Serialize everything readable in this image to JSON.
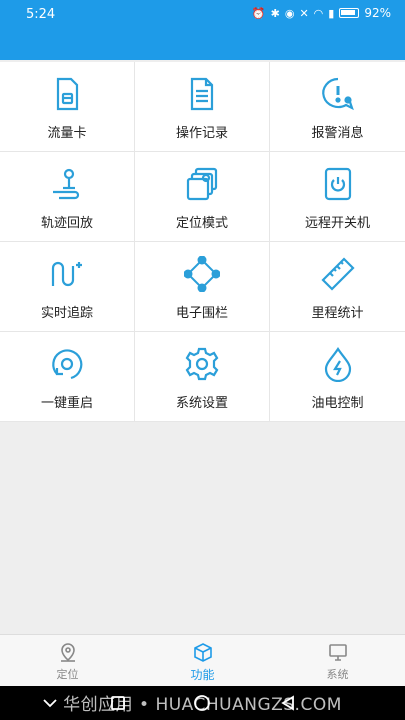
{
  "status": {
    "time": "5:24",
    "battery": "92%"
  },
  "grid": [
    {
      "label": "流量卡",
      "icon": "sim-card-icon"
    },
    {
      "label": "操作记录",
      "icon": "document-icon"
    },
    {
      "label": "报警消息",
      "icon": "alarm-message-icon"
    },
    {
      "label": "轨迹回放",
      "icon": "route-pin-icon"
    },
    {
      "label": "定位模式",
      "icon": "location-mode-icon"
    },
    {
      "label": "远程开关机",
      "icon": "power-icon"
    },
    {
      "label": "实时追踪",
      "icon": "tracking-path-icon"
    },
    {
      "label": "电子围栏",
      "icon": "fence-icon"
    },
    {
      "label": "里程统计",
      "icon": "ruler-icon"
    },
    {
      "label": "一键重启",
      "icon": "restart-icon"
    },
    {
      "label": "系统设置",
      "icon": "gear-icon"
    },
    {
      "label": "油电控制",
      "icon": "fuel-power-icon"
    }
  ],
  "tabs": [
    {
      "label": "定位",
      "icon": "location-icon",
      "active": false
    },
    {
      "label": "功能",
      "icon": "box-icon",
      "active": true
    },
    {
      "label": "系统",
      "icon": "monitor-icon",
      "active": false
    }
  ],
  "watermark": "华创应用 • HUACHUANGZS.COM",
  "colors": {
    "accent": "#1e9be8",
    "icon": "#2b9fd9"
  }
}
